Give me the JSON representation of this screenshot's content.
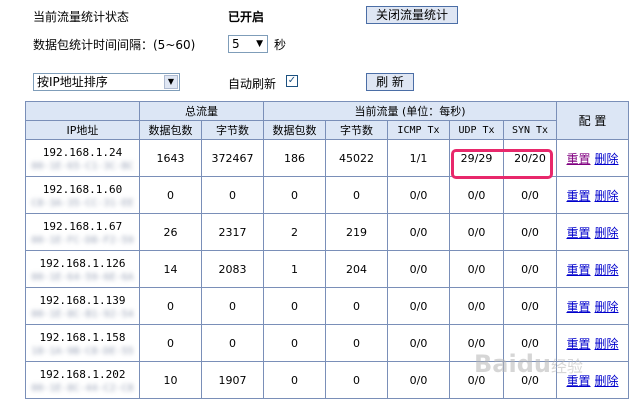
{
  "status": {
    "label": "当前流量统计状态",
    "value": "已开启",
    "toggle_button": "关闭流量统计"
  },
  "interval": {
    "label": "数据包统计时间间隔：(5~60)",
    "value": "5",
    "unit": "秒"
  },
  "sort": {
    "selected": "按IP地址排序"
  },
  "auto_refresh": {
    "label": "自动刷新",
    "checked": "✓"
  },
  "refresh_button": "刷  新",
  "table": {
    "headers": {
      "ip": "IP地址",
      "total_group": "总流量",
      "current_group": "当前流量 (单位：每秒)",
      "config": "配 置",
      "total_packets": "数据包数",
      "total_bytes": "字节数",
      "cur_packets": "数据包数",
      "cur_bytes": "字节数",
      "icmp_tx": "ICMP Tx",
      "udp_tx": "UDP Tx",
      "syn_tx": "SYN Tx"
    },
    "reset_label": "重置",
    "delete_label": "删除",
    "rows": [
      {
        "ip": "192.168.1.24",
        "mac": "00-1E-65-C1-3C-BC",
        "total_packets": "1643",
        "total_bytes": "372467",
        "cur_packets": "186",
        "cur_bytes": "45022",
        "icmp": "1/1",
        "udp": "29/29",
        "syn": "20/20"
      },
      {
        "ip": "192.168.1.60",
        "mac": "C8-3A-35-CC-31-EE",
        "total_packets": "0",
        "total_bytes": "0",
        "cur_packets": "0",
        "cur_bytes": "0",
        "icmp": "0/0",
        "udp": "0/0",
        "syn": "0/0"
      },
      {
        "ip": "192.168.1.67",
        "mac": "00-1E-FC-D8-F2-59",
        "total_packets": "26",
        "total_bytes": "2317",
        "cur_packets": "2",
        "cur_bytes": "219",
        "icmp": "0/0",
        "udp": "0/0",
        "syn": "0/0"
      },
      {
        "ip": "192.168.1.126",
        "mac": "00-1E-64-59-6E-6A",
        "total_packets": "14",
        "total_bytes": "2083",
        "cur_packets": "1",
        "cur_bytes": "204",
        "icmp": "0/0",
        "udp": "0/0",
        "syn": "0/0"
      },
      {
        "ip": "192.168.1.139",
        "mac": "00-1E-8C-B1-92-54",
        "total_packets": "0",
        "total_bytes": "0",
        "cur_packets": "0",
        "cur_bytes": "0",
        "icmp": "0/0",
        "udp": "0/0",
        "syn": "0/0"
      },
      {
        "ip": "192.168.1.158",
        "mac": "18-1A-9B-C8-DE-55",
        "total_packets": "0",
        "total_bytes": "0",
        "cur_packets": "0",
        "cur_bytes": "0",
        "icmp": "0/0",
        "udp": "0/0",
        "syn": "0/0"
      },
      {
        "ip": "192.168.1.202",
        "mac": "00-1E-8C-44-C2-C8",
        "total_packets": "10",
        "total_bytes": "1907",
        "cur_packets": "0",
        "cur_bytes": "0",
        "icmp": "0/0",
        "udp": "0/0",
        "syn": "0/0"
      }
    ]
  },
  "watermark": {
    "main": "Baidu",
    "sub": "经验"
  },
  "colors": {
    "header_bg": "#dce6f5",
    "border": "#7a8fb8",
    "link": "#0000cc",
    "highlight": "#e8286b"
  }
}
